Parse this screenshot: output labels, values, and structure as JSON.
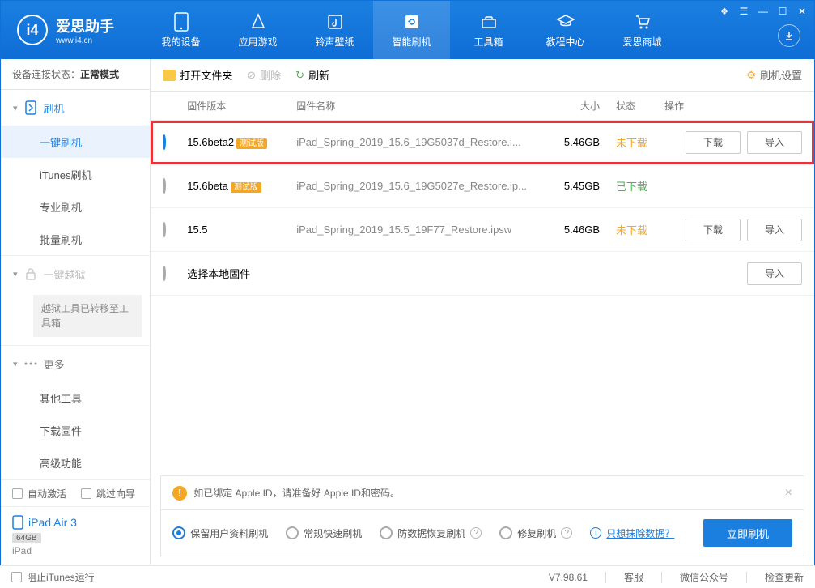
{
  "app": {
    "title": "爱思助手",
    "subtitle": "www.i4.cn"
  },
  "nav": {
    "items": [
      {
        "label": "我的设备"
      },
      {
        "label": "应用游戏"
      },
      {
        "label": "铃声壁纸"
      },
      {
        "label": "智能刷机"
      },
      {
        "label": "工具箱"
      },
      {
        "label": "教程中心"
      },
      {
        "label": "爱思商城"
      }
    ]
  },
  "toolbar": {
    "open_folder": "打开文件夹",
    "delete": "删除",
    "refresh": "刷新",
    "settings": "刷机设置"
  },
  "sidebar": {
    "device_status_label": "设备连接状态：",
    "device_status_value": "正常模式",
    "flash": "刷机",
    "items": {
      "one_click": "一键刷机",
      "itunes": "iTunes刷机",
      "pro": "专业刷机",
      "batch": "批量刷机"
    },
    "jailbreak": "一键越狱",
    "jailbreak_note": "越狱工具已转移至工具箱",
    "more": "更多",
    "more_items": {
      "other_tools": "其他工具",
      "download_fw": "下载固件",
      "advanced": "高级功能"
    },
    "auto_activate": "自动激活",
    "skip_guide": "跳过向导",
    "device_name": "iPad Air 3",
    "device_storage": "64GB",
    "device_type": "iPad"
  },
  "table": {
    "col_version": "固件版本",
    "col_name": "固件名称",
    "col_size": "大小",
    "col_status": "状态",
    "col_actions": "操作"
  },
  "firmware": [
    {
      "version": "15.6beta2",
      "beta": "测试版",
      "name": "iPad_Spring_2019_15.6_19G5037d_Restore.i...",
      "size": "5.46GB",
      "status": "未下载",
      "status_cls": "orange",
      "selected": true,
      "download": true,
      "import": true,
      "highlight": true
    },
    {
      "version": "15.6beta",
      "beta": "测试版",
      "name": "iPad_Spring_2019_15.6_19G5027e_Restore.ip...",
      "size": "5.45GB",
      "status": "已下载",
      "status_cls": "green",
      "selected": false
    },
    {
      "version": "15.5",
      "beta": "",
      "name": "iPad_Spring_2019_15.5_19F77_Restore.ipsw",
      "size": "5.46GB",
      "status": "未下载",
      "status_cls": "orange",
      "selected": false,
      "download": true,
      "import": true
    },
    {
      "version": "",
      "beta": "",
      "name_inline": "选择本地固件",
      "size": "",
      "status": "",
      "selected": false,
      "import": true
    }
  ],
  "buttons": {
    "download": "下载",
    "import": "导入"
  },
  "notice": "如已绑定 Apple ID，请准备好 Apple ID和密码。",
  "flash_options": {
    "keep_data": "保留用户资料刷机",
    "normal": "常规快速刷机",
    "anti_recovery": "防数据恢复刷机",
    "repair": "修复刷机",
    "erase_link": "只想抹除数据？",
    "flash_now": "立即刷机"
  },
  "footer": {
    "block_itunes": "阻止iTunes运行",
    "version": "V7.98.61",
    "support": "客服",
    "wechat": "微信公众号",
    "check_update": "检查更新"
  }
}
